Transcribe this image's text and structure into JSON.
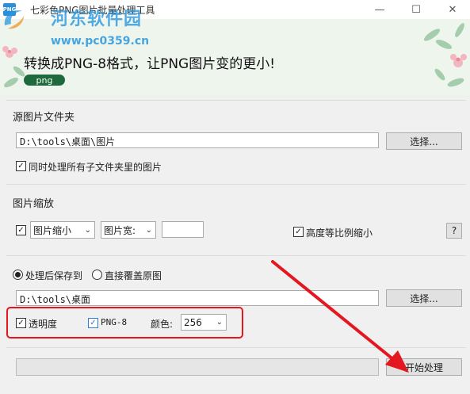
{
  "window": {
    "title": "七彩色PNG图片批量处理工具",
    "app_icon_text": "PNG",
    "minimize_glyph": "—",
    "maximize_glyph": "☐",
    "close_glyph": "✕"
  },
  "watermark": {
    "site_name": "河东软件园",
    "url": "www.pc0359.cn"
  },
  "banner": {
    "headline": "转换成PNG-8格式，让PNG图片变的更小!",
    "tag": "png"
  },
  "source_group": {
    "label": "源图片文件夹",
    "path_value": "D:\\tools\\桌面\\图片",
    "browse_label": "选择...",
    "subfolders_checked": true,
    "subfolders_label": "同时处理所有子文件夹里的图片"
  },
  "scale_group": {
    "label": "图片缩放",
    "enable_checked": true,
    "mode_selected": "图片缩小",
    "dimension_selected": "图片宽:",
    "size_value": "",
    "keep_ratio_checked": true,
    "keep_ratio_label": "高度等比例缩小",
    "help_label": "?"
  },
  "output_group": {
    "save_to_label": "处理后保存到",
    "save_to_selected": true,
    "overwrite_label": "直接覆盖原图",
    "overwrite_selected": false,
    "path_value": "D:\\tools\\桌面",
    "browse_label": "选择...",
    "transparency_checked": true,
    "transparency_label": "透明度",
    "png8_checked": true,
    "png8_label": "PNG-8",
    "colors_label": "颜色:",
    "colors_selected": "256"
  },
  "actions": {
    "start_label": "开始处理"
  },
  "colors": {
    "highlight": "#e4161f",
    "banner_bg": "#eef5ed",
    "tag_bg": "#1f6a3c"
  }
}
